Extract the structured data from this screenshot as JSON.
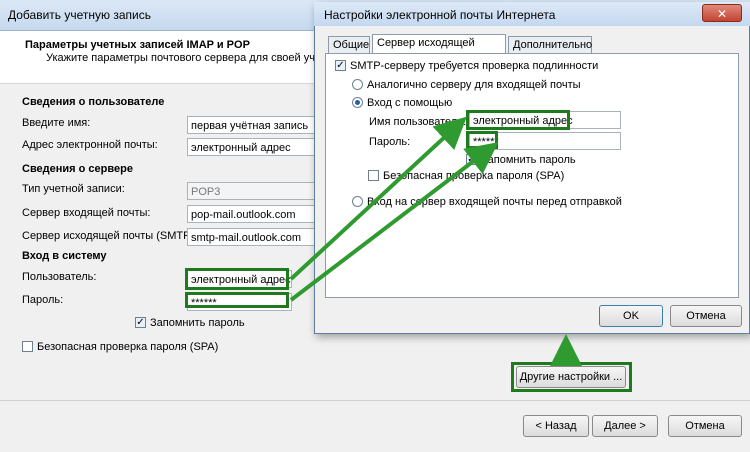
{
  "background_window": {
    "title": "Добавить учетную запись",
    "header_title": "Параметры учетных записей IMAP и POP",
    "header_subtitle": "Укажите параметры почтового сервера для своей учетно",
    "section_user": "Сведения о пользователе",
    "name_label": "Введите имя:",
    "name_value": "первая учётная запись",
    "email_label": "Адрес электронной почты:",
    "email_value": "электронный адрес",
    "section_server": "Сведения о сервере",
    "account_type_label": "Тип учетной записи:",
    "account_type_value": "POP3",
    "incoming_label": "Сервер входящей почты:",
    "incoming_value": "pop-mail.outlook.com",
    "outgoing_label": "Сервер исходящей почты (SMTP):",
    "outgoing_value": "smtp-mail.outlook.com",
    "section_login": "Вход в систему",
    "user_label": "Пользователь:",
    "user_value": "электронный адрес",
    "password_label": "Пароль:",
    "password_value": "******",
    "remember_label": "Запомнить пароль",
    "remember_checked": true,
    "spa_label": "Безопасная проверка пароля (SPA)",
    "spa_checked": false,
    "more_settings_button": "Другие настройки ...",
    "back_button": "< Назад",
    "next_button": "Далее >",
    "cancel_button": "Отмена"
  },
  "dialog": {
    "title": "Настройки электронной почты Интернета",
    "close_glyph": "✕",
    "tabs": [
      "Общие",
      "Сервер исходящей почты",
      "Дополнительно"
    ],
    "active_tab": 1,
    "smtp_auth_label": "SMTP-серверу требуется проверка подлинности",
    "smtp_auth_checked": true,
    "same_as_incoming_label": "Аналогично серверу для входящей почты",
    "login_with_label": "Вход с помощью",
    "username_label": "Имя пользователя:",
    "username_value": "электронный адрес",
    "password_label": "Пароль:",
    "password_value": "******",
    "remember_label": "Запомнить пароль",
    "remember_checked": true,
    "spa_label": "Безопасная проверка пароля (SPA)",
    "spa_checked": false,
    "login_before_send_label": "Вход на сервер входящей почты перед отправкой",
    "ok_button": "OK",
    "cancel_button": "Отмена"
  },
  "colors": {
    "highlight_green": "#1f7a1f",
    "arrow_green": "#2f9a2f"
  },
  "glyphs": {
    "check": "✓",
    "dropdown": "▾"
  }
}
